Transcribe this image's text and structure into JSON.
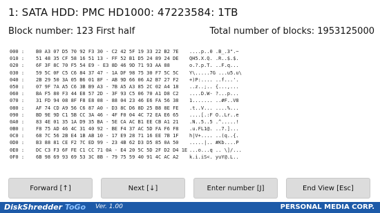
{
  "header": {
    "device_title": "1: SATA HDD: PMC HD1000: 47223584: 1TB",
    "block_number_text": "Block number: 123 First half",
    "total_blocks_text": "Total number of blocks: 1953125000"
  },
  "dump": [
    {
      "offset": "000 :",
      "hex": "B0 A3 07 D5 70 92 F3 30 - C2 42 5F 19 33 22 B2 7E",
      "ascii": "....p..0 .B_.3\".~"
    },
    {
      "offset": "010 :",
      "hex": "51 48 35 CF 58 16 51 13 - FF 52 B1 D5 24 89 24 DE",
      "ascii": "QH5.X.Q. .R..$.$."
    },
    {
      "offset": "020 :",
      "hex": "6F 3F 8C 70 F5 54 E9 - E3 8D 46 9D 71 93 AA 88",
      "ascii": "o.?.p.T. ..F.q..."
    },
    {
      "offset": "030 :",
      "hex": "59 5C 0F C5 C6 84 37 47 - 1A DF 98 75 30 F7 5C 5C",
      "ascii": "Y\\.....7G ...u5.u\\"
    },
    {
      "offset": "040 :",
      "hex": "2B 29 50 3A 05 B6 01 8F - AB 9D 66 06 A2 B7 27 F2",
      "ascii": "+)P:.... ..f...'."
    },
    {
      "offset": "050 :",
      "hex": "07 9F 7A A5 C6 3B B9 A3 - 7B A5 A3 85 2C 02 A4 18",
      "ascii": "..z..;.. {...,..."
    },
    {
      "offset": "060 :",
      "hex": "BA F5 80 F3 44 E8 57 2D - 3F 93 C5 06 70 A1 D8 C2",
      "ascii": "....D.W- ?...p..."
    },
    {
      "offset": "070 :",
      "hex": "31 FD 94 08 8F F8 E8 08 - 88 04 23 46 E6 FA 56 38",
      "ascii": "1....... ..#F..V8"
    },
    {
      "offset": "080 :",
      "hex": "AF 74 CD A9 56 C6 87 A0 - D3 8C D6 8D 25 B8 8E FE",
      "ascii": ".t..V... ....%..."
    },
    {
      "offset": "090 :",
      "hex": "BD 9E 9D C1 5B CC 3A 46 - 4F F0 04 4C 72 EA E6 65",
      "ascii": "....[.:F O..Lr..e"
    },
    {
      "offset": "0A0 :",
      "hex": "83 4E 01 35 1A D9 35 BA - 5E CA AC B1 EE CB A1 21",
      "ascii": ".N..5..5 .^.....!"
    },
    {
      "offset": "0B0 :",
      "hex": "F8 75 AD 46 4C 31 40 92 - BE F4 37 AC 5D FA F6 F8",
      "ascii": ".u.FL1@. ..7.]..."
    },
    {
      "offset": "0C0 :",
      "hex": "68 7C 56 2B E4 1B AB 10 - 17 E9 28 71 16 EE 7B 1F",
      "ascii": "h|V+.... ..(q..{."
    },
    {
      "offset": "0D0 :",
      "hex": "B3 88 81 CE F2 7C ED 99 - 23 4B 62 D3 D5 85 0A 50",
      "ascii": ".....|.. #Kb....P"
    },
    {
      "offset": "0E0 :",
      "hex": "DC C3 F3 6F FE C1 CC 71 0A - E4 20 5C 5D 2F D2 D4 1E",
      "ascii": "...o...q .. \\]/..."
    },
    {
      "offset": "0F0 :",
      "hex": "6B 98 69 93 69 53 3C 8B - 79 75 59 40 91 4C AC A2",
      "ascii": "k.i.iS<. yuY@.L.."
    }
  ],
  "buttons": {
    "forward": "Forward [↑]",
    "next": "Next [↓]",
    "enter_number": "Enter number [J]",
    "end_view": "End View [Esc]"
  },
  "footer": {
    "app_name_main": "DiskShredder ",
    "app_name_accent": "ToGo",
    "version": "Ver. 1.00",
    "company": "PERSONAL MEDIA CORP."
  }
}
